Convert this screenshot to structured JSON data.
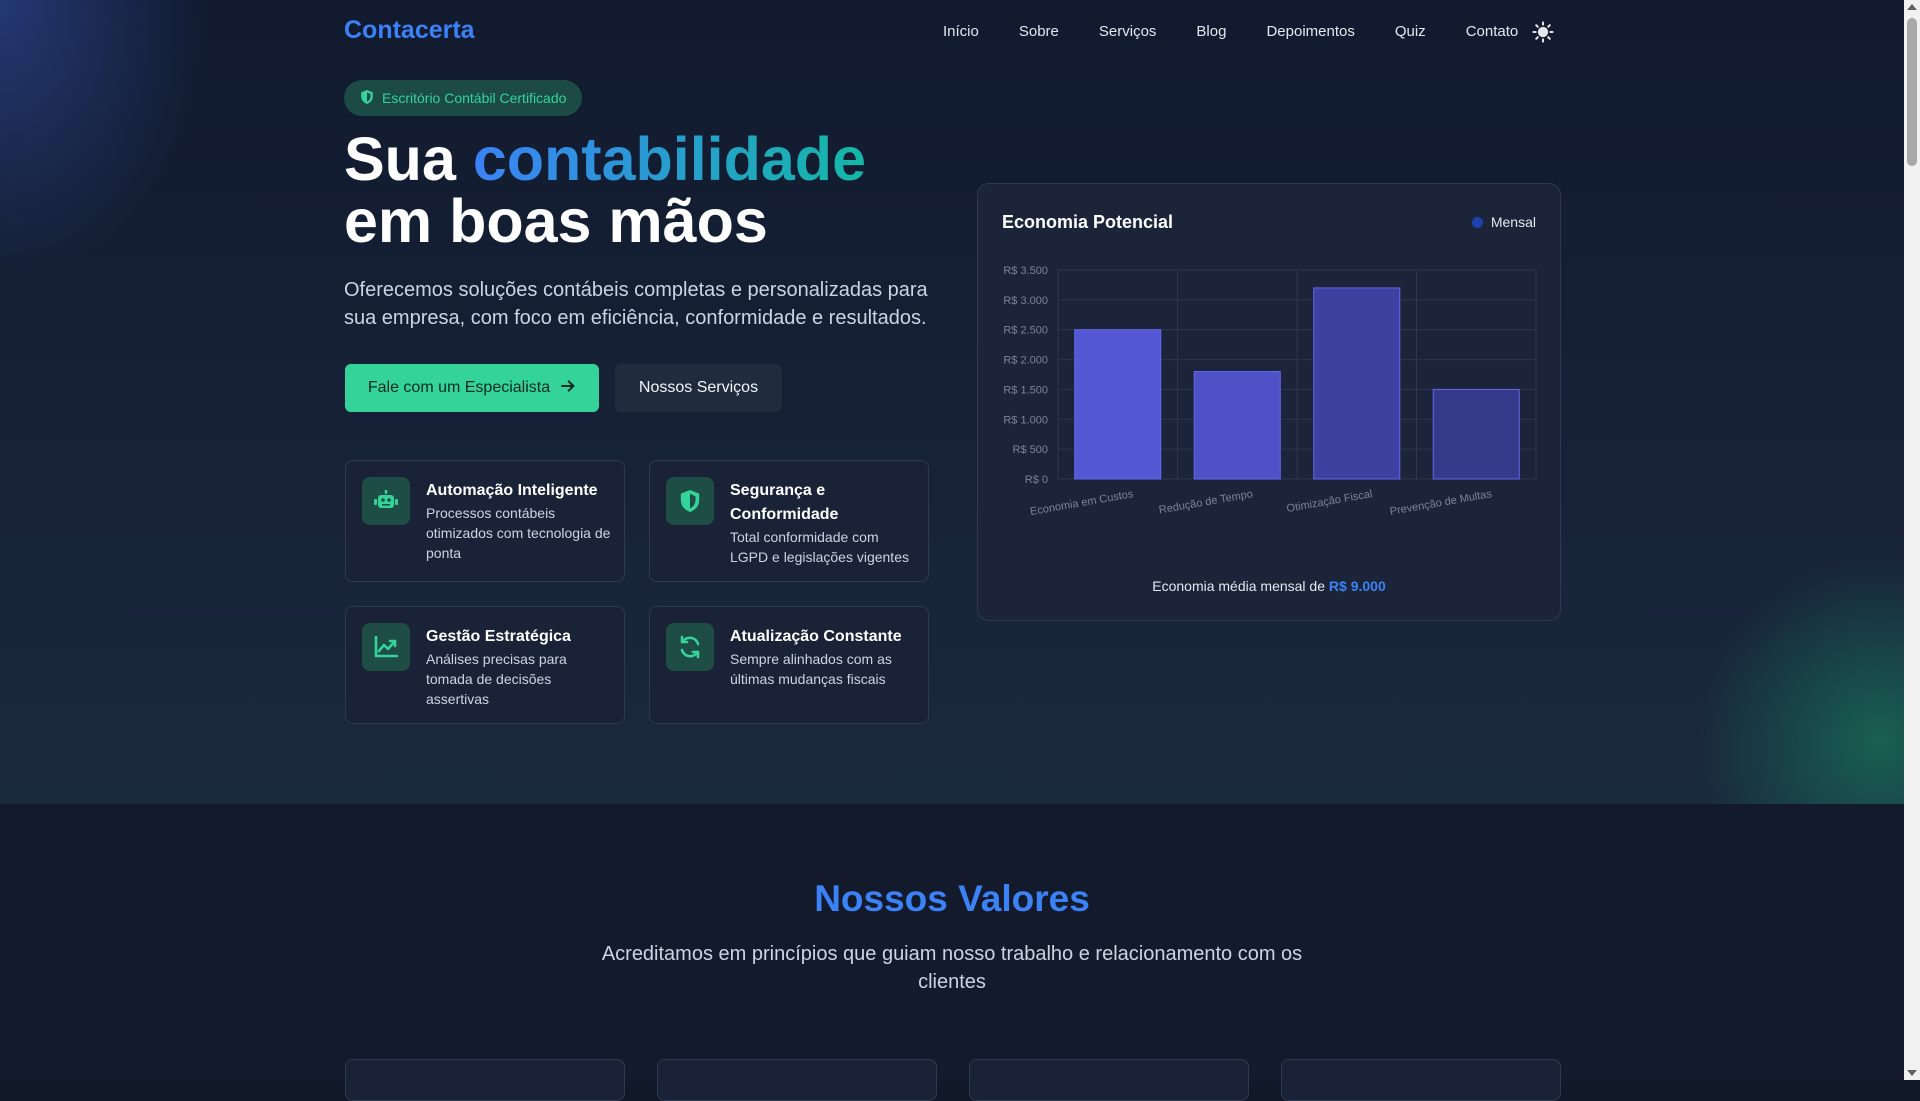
{
  "header": {
    "logo": "Contacerta",
    "nav": [
      "Início",
      "Sobre",
      "Serviços",
      "Blog",
      "Depoimentos",
      "Quiz",
      "Contato"
    ],
    "theme_icon": "sun-icon"
  },
  "hero": {
    "badge": "Escritório Contábil Certificado",
    "headline_part1": "Sua ",
    "headline_highlight": "contabilidade",
    "headline_line2": "em boas mãos",
    "lead": "Oferecemos soluções contábeis completas e personalizadas para sua empresa, com foco em eficiência, conformidade e resultados.",
    "cta_primary": "Fale com um Especialista",
    "cta_secondary": "Nossos Serviços"
  },
  "features": [
    {
      "title": "Automação Inteligente",
      "desc": "Processos contábeis otimizados com tecnologia de ponta",
      "icon": "robot-icon"
    },
    {
      "title": "Segurança e Conformidade",
      "desc": "Total conformidade com LGPD e legislações vigentes",
      "icon": "shield-icon"
    },
    {
      "title": "Gestão Estratégica",
      "desc": "Análises precisas para tomada de decisões assertivas",
      "icon": "chart-line-icon"
    },
    {
      "title": "Atualização Constante",
      "desc": "Sempre alinhados com as últimas mudanças fiscais",
      "icon": "refresh-icon"
    }
  ],
  "chart_card": {
    "title": "Economia Potencial",
    "legend": "Mensal",
    "footer_prefix": "Economia média mensal de ",
    "footer_value": "R$ 9.000"
  },
  "chart_data": {
    "type": "bar",
    "categories": [
      "Economia em Custos",
      "Redução de Tempo",
      "Otimização Fiscal",
      "Prevenção de Multas"
    ],
    "series": [
      {
        "name": "Mensal",
        "values": [
          2500,
          1800,
          3200,
          1500
        ]
      }
    ],
    "yticks": [
      "R$ 0",
      "R$ 500",
      "R$ 1.000",
      "R$ 1.500",
      "R$ 2.000",
      "R$ 2.500",
      "R$ 3.000",
      "R$ 3.500"
    ],
    "ylim": [
      0,
      3500
    ],
    "colors": [
      "#5558d4",
      "#4f52c6",
      "#3f41a0",
      "#363a8a"
    ],
    "grid": true
  },
  "values_section": {
    "title": "Nossos Valores",
    "subtitle": "Acreditamos em princípios que guiam nosso trabalho e relacionamento com os clientes"
  }
}
